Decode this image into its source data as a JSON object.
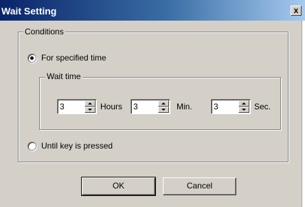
{
  "window": {
    "title": "Wait Setting",
    "close_label": "x"
  },
  "conditions": {
    "label": "Conditions",
    "option_specified_time": {
      "label": "For specified time",
      "selected": true
    },
    "option_key_pressed": {
      "label": "Until key is pressed",
      "selected": false
    }
  },
  "wait_time": {
    "label": "Wait time",
    "hours": {
      "value": "3",
      "unit": "Hours"
    },
    "minutes": {
      "value": "3",
      "unit": "Min."
    },
    "seconds": {
      "value": "3",
      "unit": "Sec."
    }
  },
  "buttons": {
    "ok": "OK",
    "cancel": "Cancel"
  }
}
